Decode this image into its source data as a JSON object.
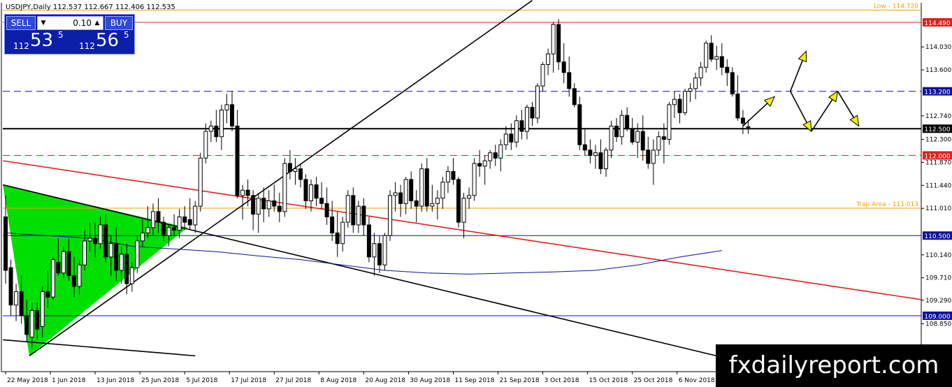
{
  "chart_data": {
    "type": "candlestick",
    "symbol_line": "USDJPY,Daily  112.537 112.667 112.406 112.535",
    "y_ticks": [
      "114.030",
      "113.600",
      "112.740",
      "112.300",
      "111.870",
      "111.440",
      "111.010",
      "110.140",
      "109.710",
      "109.290",
      "108.850"
    ],
    "x_ticks": [
      "22 May 2018",
      "1 Jun 2018",
      "13 Jun 2018",
      "25 Jun 2018",
      "5 Jul 2018",
      "17 Jul 2018",
      "27 Jul 2018",
      "8 Aug 2018",
      "20 Aug 2018",
      "30 Aug 2018",
      "11 Sep 2018",
      "21 Sep 2018",
      "3 Oct 2018",
      "15 Oct 2018",
      "25 Oct 2018",
      "6 Nov 2018"
    ],
    "ylim": [
      108.3,
      114.8
    ],
    "levels": [
      {
        "price": 114.72,
        "color": "#f0a000",
        "style": "solid",
        "label": "Low - 114.720",
        "tag": ""
      },
      {
        "price": 114.49,
        "color": "#e02020",
        "style": "solid",
        "label": "",
        "tag": "114.490"
      },
      {
        "price": 113.2,
        "color": "#1010a0",
        "style": "dashed",
        "label": "",
        "tag": "113.200"
      },
      {
        "price": 112.5,
        "color": "#000000",
        "style": "solid",
        "label": "",
        "tag": "112.500"
      },
      {
        "price": 112.0,
        "color": "#e02020",
        "style": "dashed",
        "label": "",
        "tag": "112.000"
      },
      {
        "price": 111.013,
        "color": "#f0a000",
        "style": "solid",
        "label": "Trap Area - 111.013",
        "tag": ""
      },
      {
        "price": 110.5,
        "color": "#1010a0",
        "style": "solid",
        "label": "",
        "tag": "110.500"
      },
      {
        "price": 109.0,
        "color": "#1010a0",
        "style": "solid",
        "label": "",
        "tag": "109.000"
      }
    ],
    "candles": [
      [
        110.85,
        111.25,
        109.6,
        109.85
      ],
      [
        109.9,
        110.05,
        109.0,
        109.2
      ],
      [
        109.2,
        109.6,
        108.9,
        109.45
      ],
      [
        109.45,
        109.75,
        108.85,
        109.0
      ],
      [
        109.0,
        109.3,
        108.5,
        108.65
      ],
      [
        108.6,
        109.25,
        108.4,
        109.1
      ],
      [
        109.1,
        109.25,
        108.55,
        108.75
      ],
      [
        108.8,
        109.55,
        108.6,
        109.45
      ],
      [
        109.45,
        109.85,
        109.15,
        109.35
      ],
      [
        109.35,
        110.1,
        109.3,
        110.05
      ],
      [
        110.0,
        110.45,
        109.75,
        109.8
      ],
      [
        109.8,
        110.3,
        109.7,
        110.2
      ],
      [
        110.2,
        110.45,
        109.65,
        109.75
      ],
      [
        109.75,
        110.1,
        109.35,
        109.55
      ],
      [
        109.55,
        110.05,
        109.4,
        109.95
      ],
      [
        109.95,
        110.6,
        109.85,
        110.4
      ],
      [
        110.4,
        110.75,
        110.2,
        110.45
      ],
      [
        110.45,
        110.75,
        110.1,
        110.35
      ],
      [
        110.35,
        110.85,
        110.25,
        110.7
      ],
      [
        110.7,
        110.9,
        110.0,
        110.1
      ],
      [
        110.1,
        110.5,
        109.75,
        110.35
      ],
      [
        110.35,
        110.65,
        109.65,
        109.85
      ],
      [
        109.85,
        110.3,
        109.6,
        110.15
      ],
      [
        110.15,
        110.35,
        109.4,
        109.6
      ],
      [
        109.6,
        110.0,
        109.45,
        109.9
      ],
      [
        109.9,
        110.5,
        109.8,
        110.4
      ],
      [
        110.4,
        110.8,
        110.3,
        110.55
      ],
      [
        110.55,
        111.05,
        110.45,
        110.65
      ],
      [
        110.65,
        111.1,
        110.5,
        110.95
      ],
      [
        110.95,
        111.2,
        110.55,
        110.75
      ],
      [
        110.75,
        110.85,
        110.4,
        110.5
      ],
      [
        110.5,
        110.7,
        110.3,
        110.65
      ],
      [
        110.65,
        110.9,
        110.5,
        110.6
      ],
      [
        110.6,
        111.0,
        110.45,
        110.85
      ],
      [
        110.85,
        111.05,
        110.6,
        110.75
      ],
      [
        110.8,
        111.2,
        110.6,
        110.7
      ],
      [
        110.7,
        111.15,
        110.55,
        111.05
      ],
      [
        111.05,
        112.05,
        110.95,
        111.95
      ],
      [
        111.95,
        112.6,
        111.85,
        112.45
      ],
      [
        112.45,
        112.65,
        112.25,
        112.55
      ],
      [
        112.55,
        112.85,
        112.25,
        112.35
      ],
      [
        112.35,
        112.95,
        112.1,
        112.85
      ],
      [
        112.85,
        113.15,
        112.6,
        112.95
      ],
      [
        112.95,
        113.2,
        112.45,
        112.55
      ],
      [
        112.55,
        112.85,
        111.2,
        111.25
      ],
      [
        111.25,
        111.45,
        110.8,
        111.35
      ],
      [
        111.35,
        111.55,
        111.05,
        111.25
      ],
      [
        111.25,
        111.35,
        110.6,
        110.9
      ],
      [
        110.9,
        111.3,
        110.55,
        111.2
      ],
      [
        111.2,
        111.4,
        110.75,
        111.0
      ],
      [
        111.0,
        111.35,
        110.85,
        111.15
      ],
      [
        111.15,
        111.45,
        110.95,
        111.05
      ],
      [
        111.05,
        111.3,
        110.75,
        110.95
      ],
      [
        110.95,
        111.95,
        110.85,
        111.85
      ],
      [
        111.85,
        112.1,
        111.55,
        111.7
      ],
      [
        111.7,
        111.95,
        111.45,
        111.75
      ],
      [
        111.75,
        111.85,
        111.4,
        111.55
      ],
      [
        111.55,
        111.65,
        111.0,
        111.15
      ],
      [
        111.15,
        111.55,
        110.95,
        111.45
      ],
      [
        111.45,
        111.6,
        111.05,
        111.2
      ],
      [
        111.2,
        111.5,
        111.0,
        111.1
      ],
      [
        111.1,
        111.4,
        110.7,
        110.85
      ],
      [
        110.85,
        111.15,
        110.4,
        110.55
      ],
      [
        110.55,
        110.95,
        110.1,
        110.35
      ],
      [
        110.35,
        110.85,
        110.2,
        110.75
      ],
      [
        110.75,
        111.35,
        110.65,
        111.25
      ],
      [
        111.25,
        111.4,
        110.55,
        110.7
      ],
      [
        110.7,
        111.15,
        110.55,
        111.05
      ],
      [
        111.05,
        111.2,
        110.5,
        110.7
      ],
      [
        110.7,
        110.85,
        110.0,
        110.1
      ],
      [
        110.1,
        110.55,
        109.75,
        110.35
      ],
      [
        110.35,
        110.5,
        109.8,
        109.95
      ],
      [
        109.95,
        110.55,
        109.85,
        110.5
      ],
      [
        110.5,
        111.35,
        110.4,
        111.25
      ],
      [
        111.25,
        111.5,
        110.95,
        111.3
      ],
      [
        111.3,
        111.45,
        110.85,
        111.1
      ],
      [
        111.1,
        111.6,
        110.9,
        111.55
      ],
      [
        111.55,
        111.7,
        111.0,
        111.15
      ],
      [
        111.15,
        111.35,
        110.75,
        111.05
      ],
      [
        111.05,
        111.85,
        110.95,
        111.75
      ],
      [
        111.75,
        111.95,
        110.95,
        111.05
      ],
      [
        111.05,
        111.45,
        110.95,
        111.1
      ],
      [
        111.1,
        111.35,
        110.8,
        111.2
      ],
      [
        111.2,
        111.6,
        111.0,
        111.5
      ],
      [
        111.5,
        111.8,
        111.3,
        111.7
      ],
      [
        111.7,
        111.95,
        111.45,
        111.55
      ],
      [
        111.55,
        111.6,
        110.65,
        110.75
      ],
      [
        110.75,
        111.3,
        110.45,
        111.2
      ],
      [
        111.2,
        111.4,
        111.0,
        111.25
      ],
      [
        111.25,
        111.95,
        111.15,
        111.85
      ],
      [
        111.85,
        112.1,
        111.6,
        111.8
      ],
      [
        111.8,
        112.0,
        111.45,
        111.9
      ],
      [
        111.9,
        112.1,
        111.75,
        112.05
      ],
      [
        112.05,
        112.2,
        111.8,
        111.95
      ],
      [
        111.95,
        112.3,
        111.7,
        112.2
      ],
      [
        112.2,
        112.55,
        112.1,
        112.4
      ],
      [
        112.4,
        112.6,
        112.1,
        112.25
      ],
      [
        112.25,
        112.75,
        112.15,
        112.65
      ],
      [
        112.65,
        112.85,
        112.3,
        112.45
      ],
      [
        112.45,
        112.95,
        112.3,
        112.9
      ],
      [
        112.9,
        113.0,
        112.55,
        112.7
      ],
      [
        112.7,
        113.35,
        112.6,
        113.3
      ],
      [
        113.3,
        113.75,
        113.2,
        113.7
      ],
      [
        113.7,
        114.0,
        113.5,
        113.9
      ],
      [
        113.9,
        114.5,
        113.55,
        114.45
      ],
      [
        114.45,
        114.55,
        113.6,
        113.75
      ],
      [
        113.75,
        114.1,
        113.35,
        113.55
      ],
      [
        113.55,
        113.85,
        113.1,
        113.25
      ],
      [
        113.25,
        113.35,
        112.9,
        112.95
      ],
      [
        112.95,
        113.1,
        112.1,
        112.2
      ],
      [
        112.2,
        112.5,
        112.0,
        112.1
      ],
      [
        112.1,
        112.3,
        111.85,
        112.0
      ],
      [
        112.0,
        112.2,
        111.75,
        112.05
      ],
      [
        112.05,
        112.3,
        111.65,
        111.75
      ],
      [
        111.75,
        112.15,
        111.6,
        112.1
      ],
      [
        112.1,
        112.65,
        111.95,
        112.55
      ],
      [
        112.55,
        112.7,
        112.25,
        112.35
      ],
      [
        112.35,
        112.85,
        112.2,
        112.75
      ],
      [
        112.75,
        112.9,
        112.45,
        112.5
      ],
      [
        112.5,
        112.7,
        112.2,
        112.25
      ],
      [
        112.25,
        112.6,
        111.95,
        112.45
      ],
      [
        112.45,
        112.75,
        111.9,
        112.1
      ],
      [
        112.1,
        112.35,
        111.75,
        111.85
      ],
      [
        111.85,
        112.3,
        111.45,
        112.1
      ],
      [
        112.1,
        112.45,
        112.0,
        112.35
      ],
      [
        112.35,
        112.6,
        111.85,
        112.3
      ],
      [
        112.3,
        113.0,
        112.2,
        112.95
      ],
      [
        112.95,
        113.2,
        112.7,
        113.05
      ],
      [
        113.05,
        113.15,
        112.6,
        112.8
      ],
      [
        112.8,
        113.25,
        112.75,
        113.2
      ],
      [
        113.2,
        113.35,
        113.0,
        113.25
      ],
      [
        113.25,
        113.55,
        113.05,
        113.45
      ],
      [
        113.45,
        113.75,
        113.3,
        113.65
      ],
      [
        113.65,
        114.15,
        113.55,
        114.1
      ],
      [
        114.1,
        114.25,
        113.75,
        113.8
      ],
      [
        113.8,
        114.05,
        113.6,
        113.85
      ],
      [
        113.85,
        114.1,
        113.5,
        113.65
      ],
      [
        113.65,
        113.8,
        113.3,
        113.55
      ],
      [
        113.55,
        113.65,
        113.1,
        113.15
      ],
      [
        113.15,
        113.5,
        112.65,
        112.7
      ],
      [
        112.7,
        112.85,
        112.4,
        112.6
      ],
      [
        112.537,
        112.667,
        112.406,
        112.535
      ]
    ],
    "moving_average": [
      [
        110.55,
        110.45
      ],
      [
        110.8,
        110.25
      ],
      [
        110.9,
        110.2
      ],
      [
        111.1,
        110.15
      ],
      [
        110.55,
        110.1
      ],
      [
        111.0,
        110.1
      ],
      [
        112.0,
        110.2
      ],
      [
        112.2,
        110.3
      ],
      [
        112.3,
        110.35
      ],
      [
        113.7,
        110.4
      ],
      [
        114.0,
        110.45
      ],
      [
        114.3,
        110.55
      ],
      [
        114.6,
        110.65
      ],
      [
        114.8,
        110.7
      ],
      [
        115.2,
        110.75
      ],
      [
        115.8,
        110.82
      ],
      [
        116.2,
        110.88
      ]
    ]
  },
  "panel": {
    "sell_label": "SELL",
    "buy_label": "BUY",
    "lot_value": "0.10",
    "sell_prefix": "112",
    "sell_main": "53",
    "sell_sup": "5",
    "buy_prefix": "112",
    "buy_main": "56",
    "buy_sup": "5",
    "arrow_down": "▼",
    "arrow_up": "▲"
  },
  "brand_text": "fxdailyreport.com",
  "colors": {
    "bull": "#ffffff",
    "bear": "#000000",
    "trendline": "#000000",
    "red_trend": "#e02020",
    "triangle": "#00e000",
    "ma": "#1010a0",
    "arrows": "#f0f000"
  }
}
